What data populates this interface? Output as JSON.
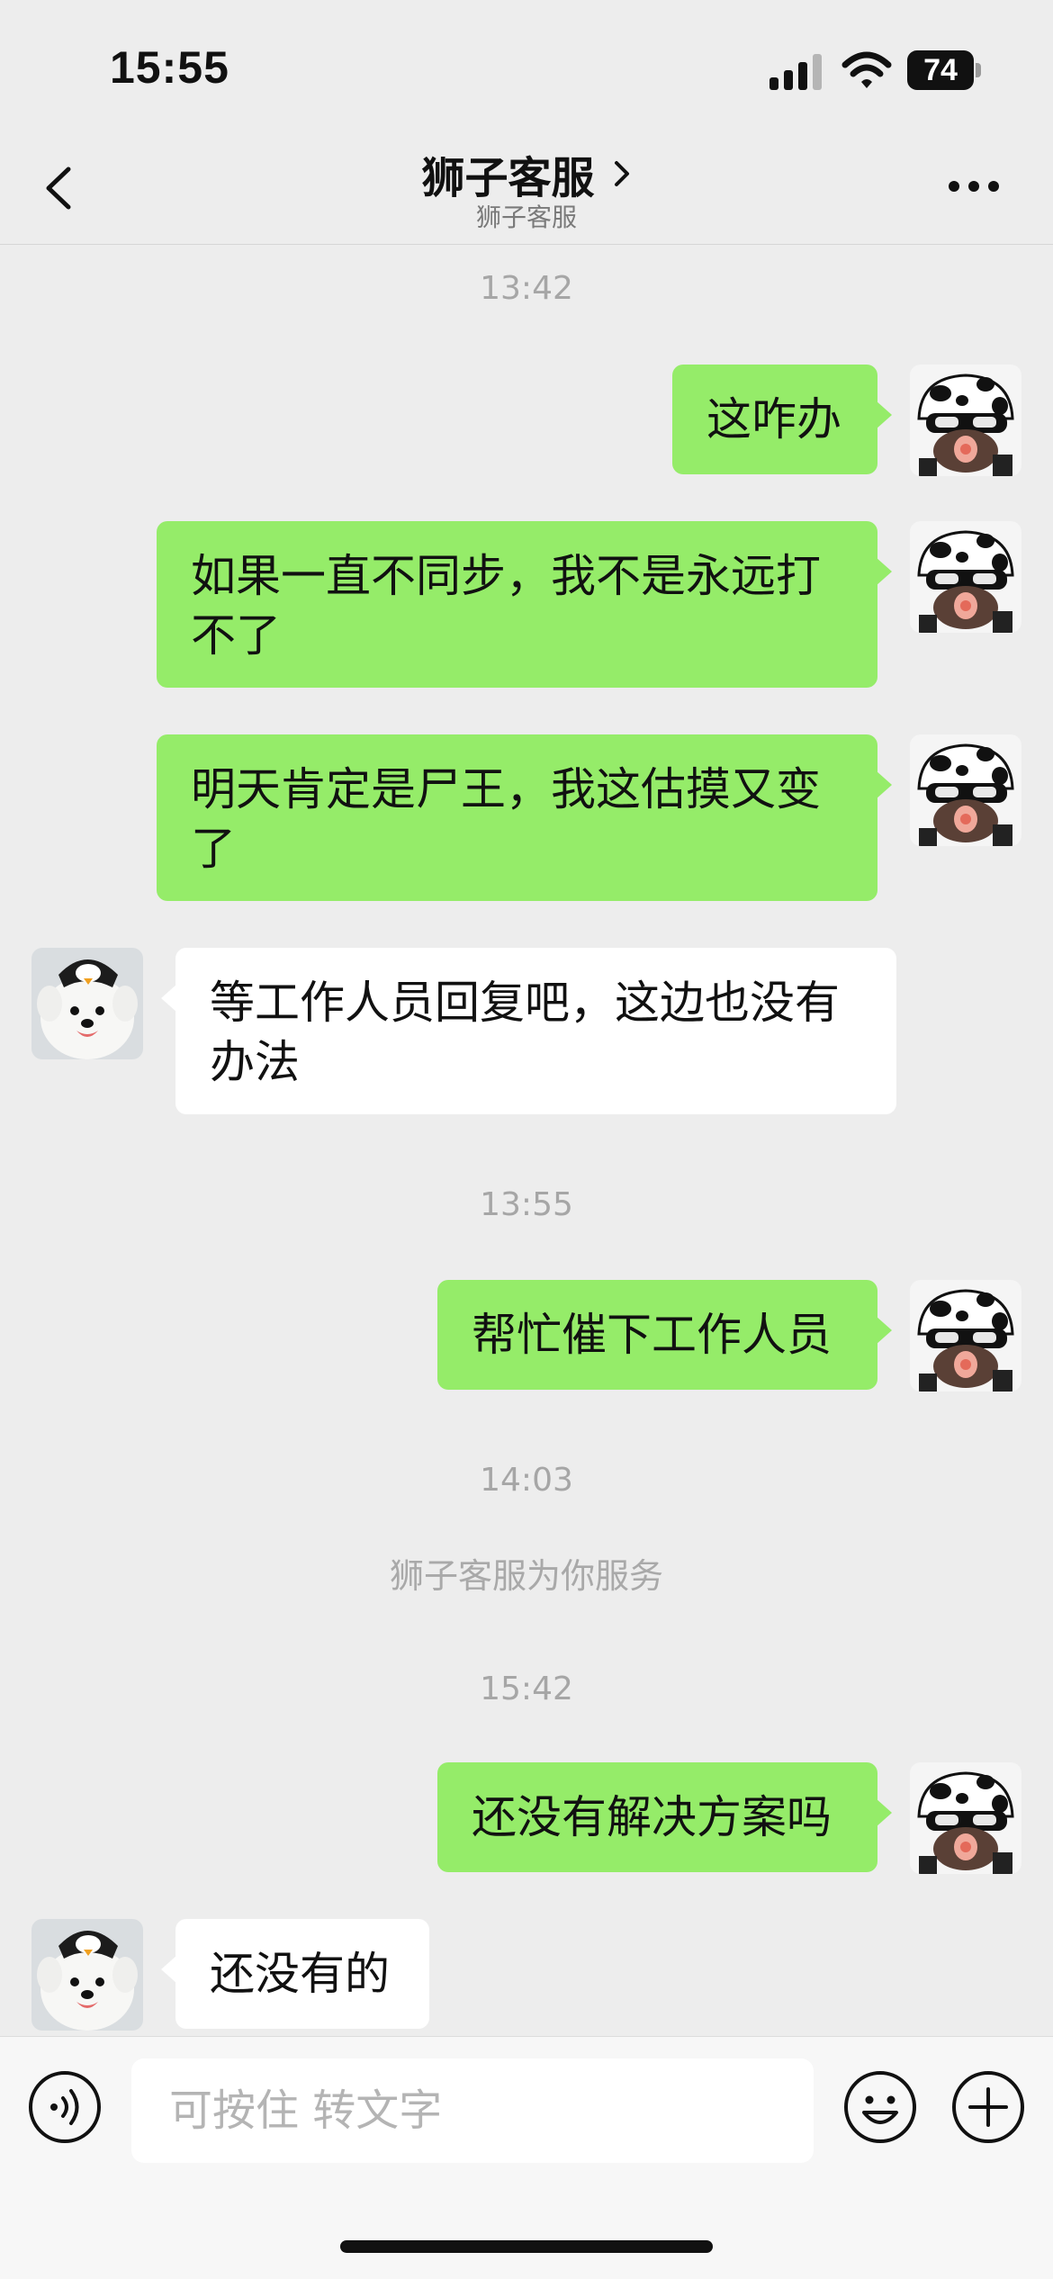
{
  "status_bar": {
    "time": "15:55",
    "battery": "74"
  },
  "header": {
    "title": "狮子客服",
    "subtitle": "狮子客服"
  },
  "chat": {
    "timestamps": [
      "13:42",
      "13:55",
      "14:03",
      "15:42"
    ],
    "system_message": "狮子客服为你服务",
    "messages": [
      {
        "from": "me",
        "lines": [
          "这咋办"
        ]
      },
      {
        "from": "me",
        "lines": [
          "如果一直不同步，我不是永远打",
          "不了"
        ]
      },
      {
        "from": "me",
        "lines": [
          "明天肯定是尸王，我这估摸又变",
          "了"
        ]
      },
      {
        "from": "agent",
        "lines": [
          "等工作人员回复吧，这边也没有",
          "办法"
        ]
      },
      {
        "from": "me",
        "lines": [
          "帮忙催下工作人员"
        ]
      },
      {
        "from": "me",
        "lines": [
          "还没有解决方案吗"
        ]
      },
      {
        "from": "agent",
        "lines": [
          "还没有的"
        ]
      }
    ]
  },
  "input_bar": {
    "placeholder": "可按住 转文字"
  },
  "colors": {
    "background": "#ededed",
    "bubble_out": "#95ec69",
    "bubble_in": "#ffffff",
    "timestamp_text": "#a6a6a6"
  },
  "icons": {
    "back": "chevron-left-icon",
    "title_chevron": "chevron-right-icon",
    "more": "ellipsis-icon",
    "voice": "voice-icon",
    "emoji": "smiley-icon",
    "plus": "plus-icon",
    "signal": "signal-icon",
    "wifi": "wifi-icon",
    "battery": "battery-icon"
  }
}
